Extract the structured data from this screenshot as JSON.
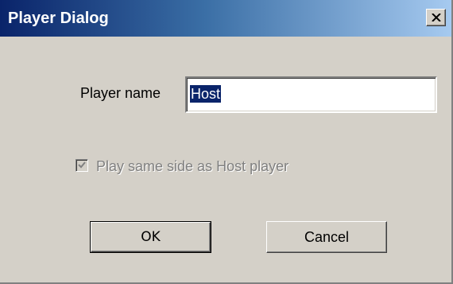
{
  "window": {
    "title": "Player Dialog",
    "close_icon": "close-icon"
  },
  "form": {
    "player_name_label": "Player name",
    "player_name_value": "Host",
    "same_side_label": "Play same side as Host player",
    "same_side_checked": true,
    "same_side_enabled": false
  },
  "buttons": {
    "ok_label": "OK",
    "cancel_label": "Cancel"
  },
  "colors": {
    "titlebar_start": "#0a246a",
    "titlebar_end": "#a6caf0",
    "face": "#d4d0c8",
    "selection": "#0a246a",
    "disabled_text": "#808080"
  }
}
